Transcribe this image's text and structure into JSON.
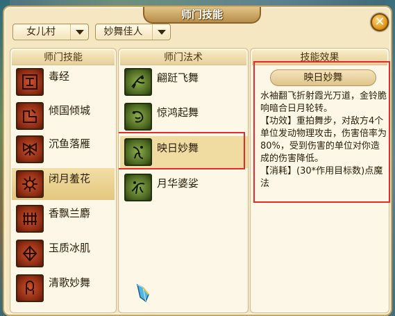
{
  "window": {
    "title": "师门技能"
  },
  "filters": {
    "sect": "女儿村",
    "path": "妙舞佳人"
  },
  "sect_skills": {
    "header": "师门技能",
    "items": [
      {
        "label": "毒经",
        "icon": "poison-scroll-icon"
      },
      {
        "label": "倾国倾城",
        "icon": "charm-icon"
      },
      {
        "label": "沉鱼落雁",
        "icon": "moth-icon"
      },
      {
        "label": "闭月羞花",
        "icon": "flower-mandala-icon",
        "selected": true
      },
      {
        "label": "香飘兰麝",
        "icon": "orchid-icon"
      },
      {
        "label": "玉质冰肌",
        "icon": "ice-jade-icon"
      },
      {
        "label": "清歌妙舞",
        "icon": "dancer-icon"
      }
    ]
  },
  "sect_spells": {
    "header": "师门法术",
    "items": [
      {
        "label": "翩跹飞舞",
        "icon": "flying-dancer-icon"
      },
      {
        "label": "惊鸿起舞",
        "icon": "swan-dance-icon"
      },
      {
        "label": "映日妙舞",
        "icon": "sun-dance-icon",
        "selected": true
      },
      {
        "label": "月华婆娑",
        "icon": "moon-dance-icon"
      }
    ]
  },
  "effect": {
    "header": "技能效果",
    "name": "映日妙舞",
    "description": "水袖翻飞折射霞光万道，金铃脆响暗合日月轮转。",
    "effect_label": "【功效】",
    "effect_text": "重拍舞步，对敌方4个单位发动物理攻击，伤害倍率为80%，受到伤害的单位对你造成的伤害降低。",
    "cost_label": "【消耗】",
    "cost_text": "(30*作用目标数)点魔法"
  },
  "colors": {
    "highlight_border": "#e52a2a",
    "panel_bg": "#fcf7e6",
    "window_bg": "#f4e7c2",
    "selected_row": "#f0dca0"
  }
}
